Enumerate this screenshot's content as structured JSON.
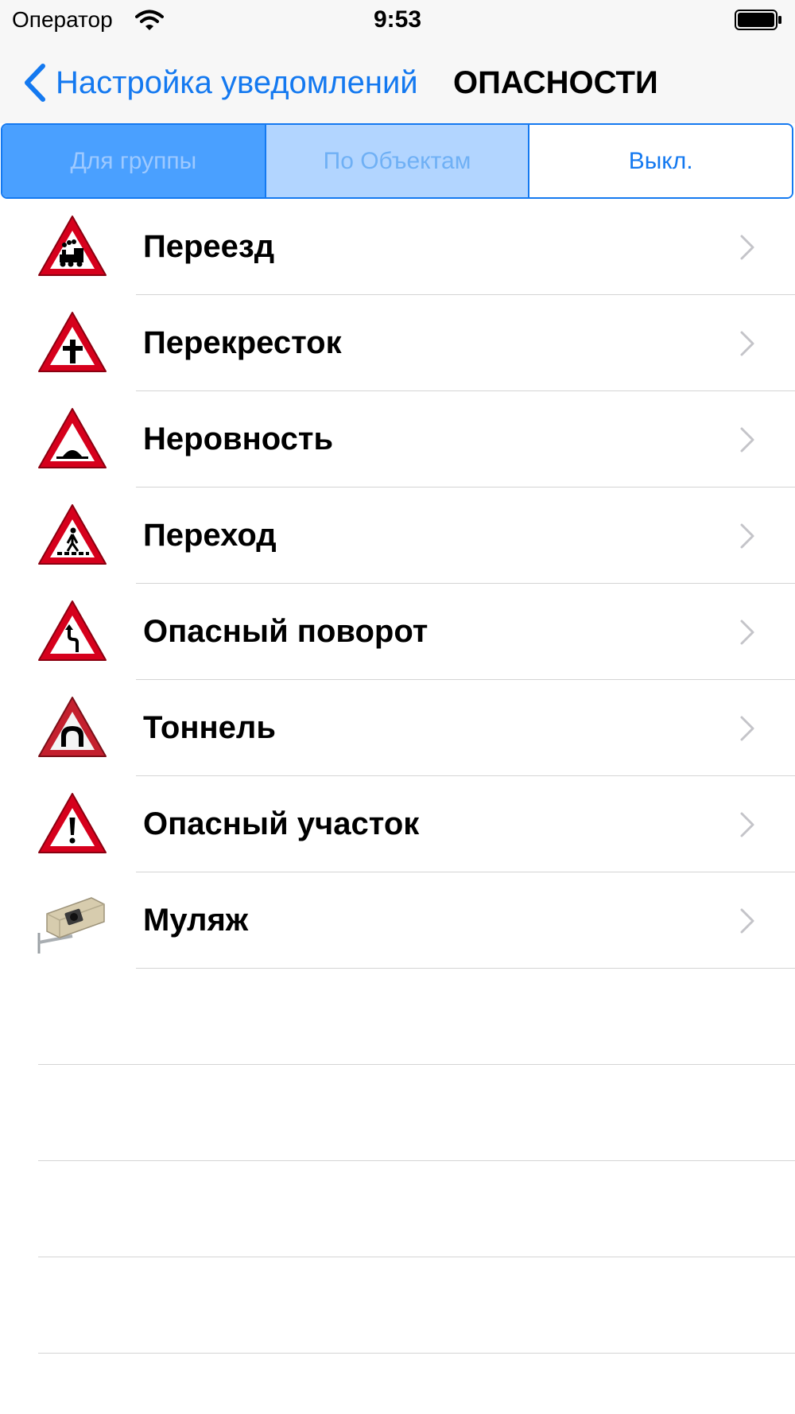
{
  "status_bar": {
    "carrier": "Оператор",
    "time": "9:53",
    "wifi_icon": "wifi-icon",
    "battery_icon": "battery-icon"
  },
  "nav": {
    "back_label": "Настройка уведомлений",
    "title": "ОПАСНОСТИ",
    "accent_color": "#1479f0"
  },
  "segmented": {
    "options": [
      "Для группы",
      "По Объектам",
      "Выкл."
    ],
    "selected": "Выкл."
  },
  "list": {
    "items": [
      {
        "label": "Переезд",
        "icon": "railway-crossing-sign-icon"
      },
      {
        "label": "Перекресток",
        "icon": "intersection-sign-icon"
      },
      {
        "label": "Неровность",
        "icon": "bump-sign-icon"
      },
      {
        "label": "Переход",
        "icon": "pedestrian-crossing-sign-icon"
      },
      {
        "label": "Опасный поворот",
        "icon": "dangerous-curve-sign-icon"
      },
      {
        "label": "Тоннель",
        "icon": "tunnel-sign-icon"
      },
      {
        "label": "Опасный участок",
        "icon": "danger-warning-sign-icon"
      },
      {
        "label": "Муляж",
        "icon": "dummy-camera-icon"
      }
    ]
  }
}
